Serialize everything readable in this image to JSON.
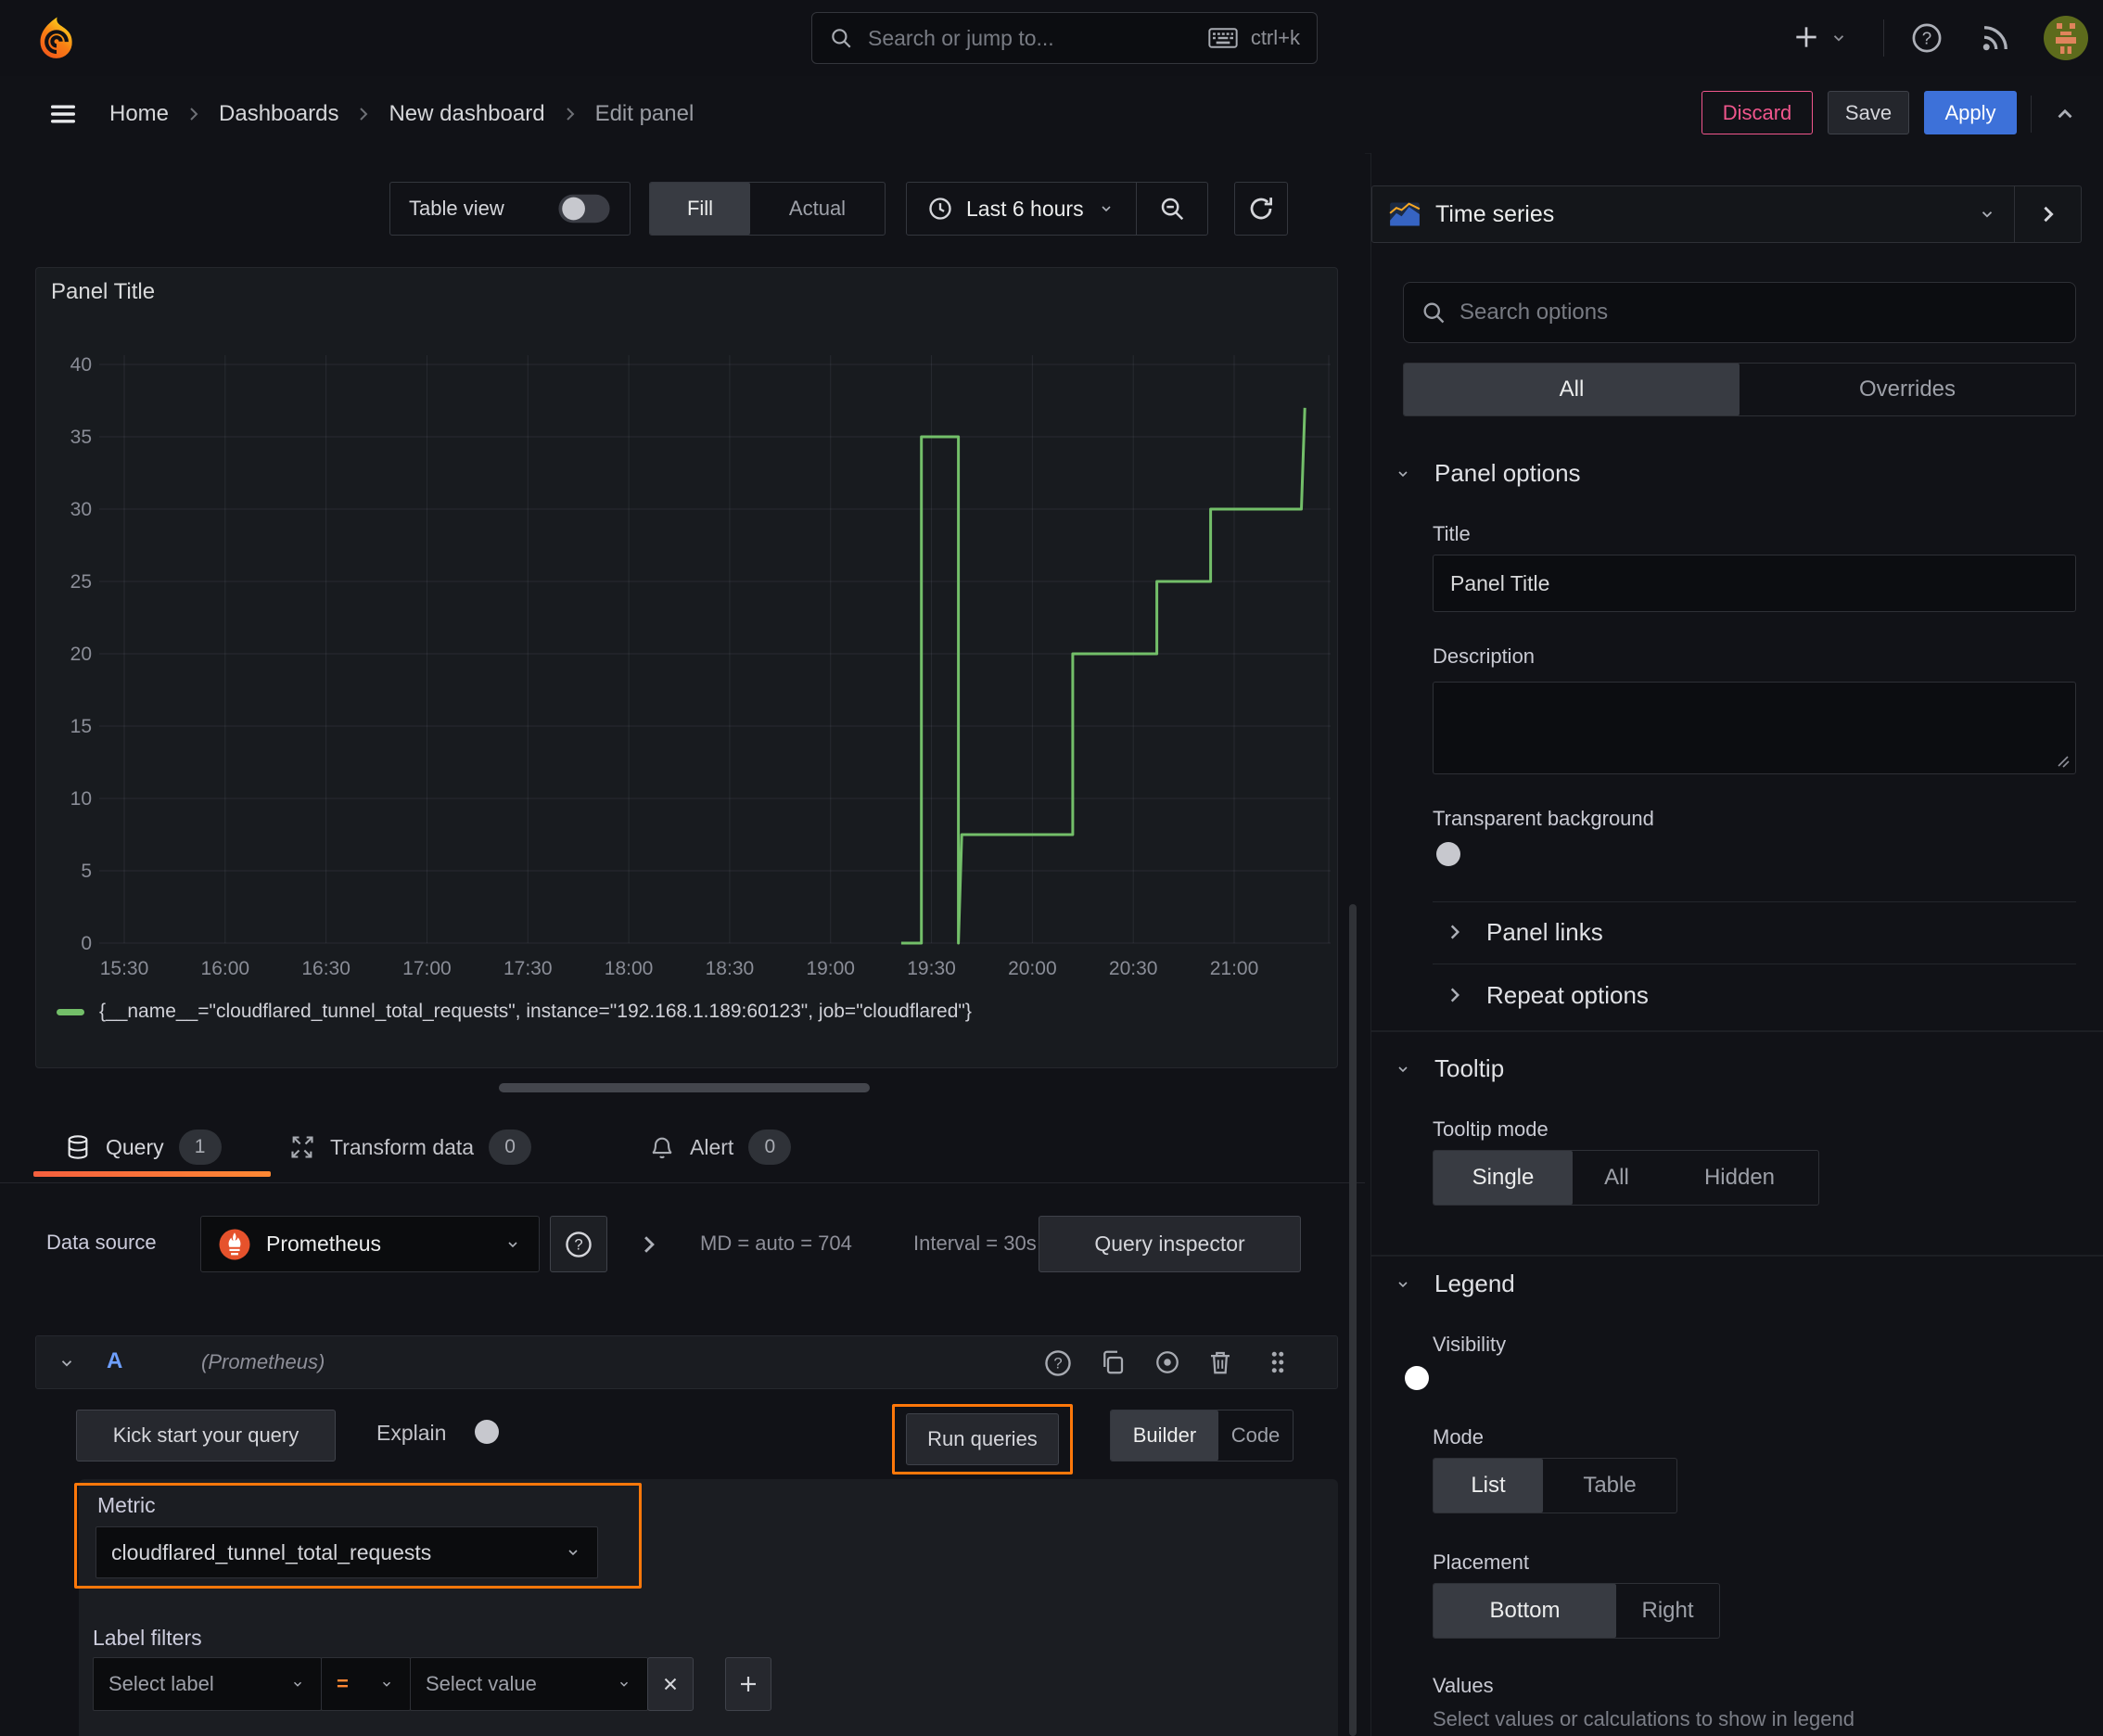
{
  "topnav": {
    "search_placeholder": "Search or jump to...",
    "shortcut": "ctrl+k"
  },
  "breadcrumb": {
    "items": [
      "Home",
      "Dashboards",
      "New dashboard"
    ],
    "current": "Edit panel",
    "discard": "Discard",
    "save": "Save",
    "apply": "Apply"
  },
  "toolbar": {
    "table_view": "Table view",
    "fill": "Fill",
    "actual": "Actual",
    "time_range": "Last 6 hours"
  },
  "panel": {
    "title": "Panel Title"
  },
  "chart_data": {
    "type": "line",
    "line_mode": "step-after",
    "title": "Panel Title",
    "xlabel": "",
    "ylabel": "",
    "ylim": [
      0,
      40
    ],
    "y_ticks": [
      0,
      5,
      10,
      15,
      20,
      25,
      30,
      35,
      40
    ],
    "x_ticks": [
      "15:30",
      "16:00",
      "16:30",
      "17:00",
      "17:30",
      "18:00",
      "18:30",
      "19:00",
      "19:30",
      "20:00",
      "20:30",
      "21:00"
    ],
    "x_tick_minutes": [
      0,
      30,
      60,
      90,
      120,
      150,
      180,
      210,
      240,
      270,
      300,
      330
    ],
    "x_range_minutes": [
      0,
      359
    ],
    "grid": true,
    "legend_position": "bottom",
    "series": [
      {
        "name": "{__name__=\"cloudflared_tunnel_total_requests\", instance=\"192.168.1.189:60123\", job=\"cloudflared\"}",
        "color": "#73bf69",
        "points_format": "[minutes_after_15:30, value]",
        "points": [
          [
            231,
            0
          ],
          [
            237,
            0
          ],
          [
            237,
            35
          ],
          [
            248,
            35
          ],
          [
            248,
            0
          ],
          [
            249,
            7.5
          ],
          [
            282,
            7.5
          ],
          [
            282,
            20
          ],
          [
            307,
            20
          ],
          [
            307,
            25
          ],
          [
            323,
            25
          ],
          [
            323,
            30
          ],
          [
            350,
            30
          ],
          [
            351,
            37
          ]
        ]
      }
    ]
  },
  "tabs": {
    "query": "Query",
    "query_count": "1",
    "transform": "Transform data",
    "transform_count": "0",
    "alert": "Alert",
    "alert_count": "0"
  },
  "datasource": {
    "label": "Data source",
    "name": "Prometheus",
    "md": "MD = auto = 704",
    "interval": "Interval = 30s",
    "inspector": "Query inspector"
  },
  "query": {
    "ref": "A",
    "ds_hint": "(Prometheus)",
    "kickstart": "Kick start your query",
    "explain": "Explain",
    "run": "Run queries",
    "builder": "Builder",
    "code": "Code",
    "metric_label": "Metric",
    "metric_value": "cloudflared_tunnel_total_requests",
    "label_filters": "Label filters",
    "select_label": "Select label",
    "op": "=",
    "select_value": "Select value"
  },
  "sidebar": {
    "viz": "Time series",
    "search_placeholder": "Search options",
    "tab_all": "All",
    "tab_overrides": "Overrides",
    "panel_options": {
      "heading": "Panel options",
      "title_label": "Title",
      "title_value": "Panel Title",
      "description_label": "Description",
      "transparent": "Transparent background"
    },
    "panel_links": "Panel links",
    "repeat_options": "Repeat options",
    "tooltip": {
      "heading": "Tooltip",
      "mode_label": "Tooltip mode",
      "single": "Single",
      "all": "All",
      "hidden": "Hidden"
    },
    "legend": {
      "heading": "Legend",
      "visibility": "Visibility",
      "mode_label": "Mode",
      "list": "List",
      "table": "Table",
      "placement_label": "Placement",
      "bottom": "Bottom",
      "right": "Right",
      "values_label": "Values",
      "values_hint": "Select values or calculations to show in legend"
    }
  },
  "colors": {
    "accent_orange": "#ff780a",
    "series_green": "#73bf69",
    "primary_blue": "#3d71d9",
    "danger_pink": "#f0568c"
  },
  "icons": [
    "grafana-logo",
    "search",
    "keyboard",
    "plus",
    "chevron-down",
    "help",
    "rss",
    "avatar",
    "menu",
    "clock",
    "zoom-out",
    "refresh",
    "database",
    "transform",
    "bell",
    "copy",
    "eye",
    "trash",
    "grip",
    "close",
    "add",
    "chevron-right",
    "chevron-up",
    "time-series-viz",
    "prometheus"
  ]
}
